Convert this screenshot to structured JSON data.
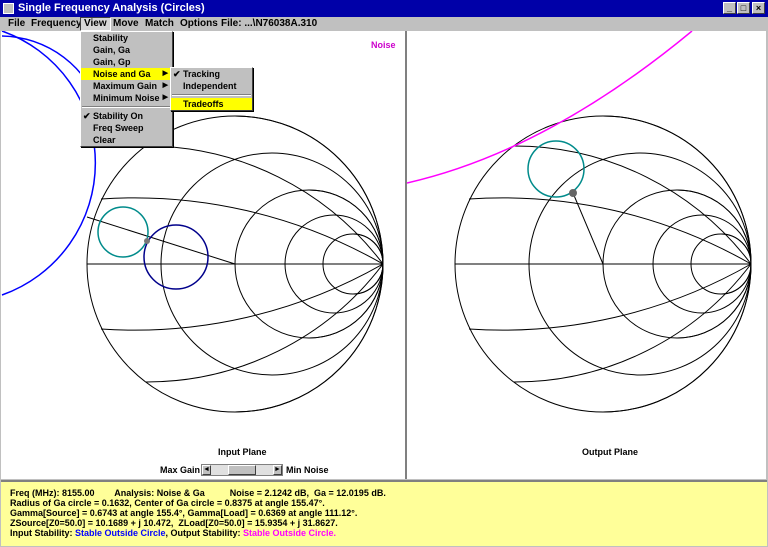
{
  "window": {
    "title": "Single Frequency Analysis (Circles)",
    "minimize": "_",
    "maximize": "□",
    "close": "×"
  },
  "menu": {
    "file": "File",
    "frequency": "Frequency",
    "view": "View",
    "move": "Move",
    "match": "Match",
    "options": "Options",
    "file_info": "File: ...\\N76038A.310"
  },
  "view_menu": {
    "items": [
      "Stability",
      "Gain, Ga",
      "Gain, Gp",
      "Noise and Ga",
      "Maximum Gain",
      "Minimum Noise",
      "Stability On",
      "Freq Sweep",
      "Clear"
    ]
  },
  "noise_submenu": {
    "items": [
      "Tracking",
      "Independent",
      "Tradeoffs"
    ]
  },
  "plots": {
    "input_label": "Input Plane",
    "output_label": "Output Plane",
    "noise_label": "Noise"
  },
  "slider": {
    "left": "Max Gain",
    "right": "Min Noise",
    "left_arrow": "◄",
    "right_arrow": "►",
    "position": 0.45
  },
  "info": {
    "line1": "Freq (MHz): 8155.00        Analysis: Noise & Ga          Noise = 2.1242 dB,  Ga = 12.0195 dB.",
    "line2": "Radius of Ga circle = 0.1632, Center of Ga circle = 0.8375 at angle 155.47°.",
    "line3": "Gamma[Source] = 0.6743 at angle 155.4°, Gamma[Load] = 0.6369 at angle 111.12°.",
    "line4": "ZSource[Z0=50.0] = 10.1689 + j 10.472,  ZLoad[Z0=50.0] = 15.9354 + j 31.8627.",
    "input_stab_label": "Input Stability: ",
    "input_stab_value": "Stable Outside Circle",
    "output_stab_label": ", Output Stability: ",
    "output_stab_value": "Stable Outside Circle."
  },
  "colors": {
    "title_bg": "#0000a8",
    "info_bg": "#ffff99",
    "stab_blue": "#0000ff",
    "stab_magenta": "#ff00ff",
    "ga_circle": "#008b8b",
    "noise_circle": "#00008b"
  }
}
